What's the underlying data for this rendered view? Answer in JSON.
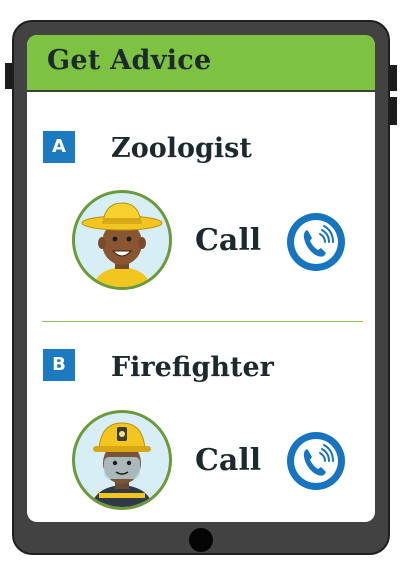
{
  "header": {
    "title": "Get Advice"
  },
  "experts": [
    {
      "badge": "A",
      "name": "Zoologist",
      "call_label": "Call",
      "avatar_icon": "zoologist-avatar-icon"
    },
    {
      "badge": "B",
      "name": "Firefighter",
      "call_label": "Call",
      "avatar_icon": "firefighter-avatar-icon"
    }
  ],
  "icons": {
    "call": "phone-ringing-icon",
    "home": "home-button"
  },
  "colors": {
    "header_bg": "#7ec242",
    "badge_bg": "#1c7ac0",
    "call_button": "#1774bf",
    "tablet_frame": "#424242",
    "avatar_border": "#6b9a3a"
  }
}
